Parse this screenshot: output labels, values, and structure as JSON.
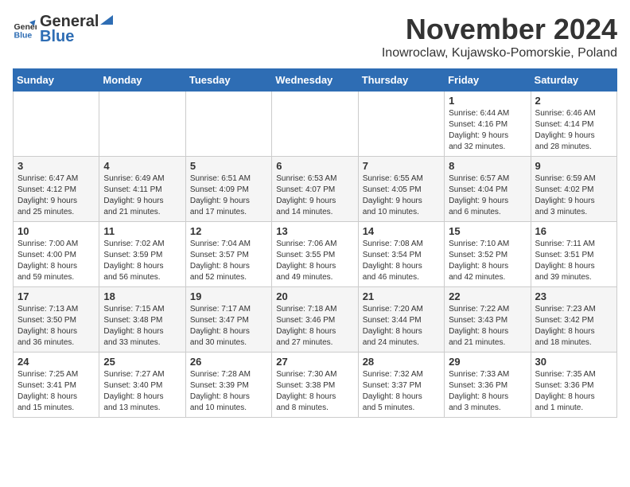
{
  "logo": {
    "general": "General",
    "blue": "Blue"
  },
  "title": "November 2024",
  "location": "Inowroclaw, Kujawsko-Pomorskie, Poland",
  "weekdays": [
    "Sunday",
    "Monday",
    "Tuesday",
    "Wednesday",
    "Thursday",
    "Friday",
    "Saturday"
  ],
  "weeks": [
    [
      {
        "day": "",
        "info": ""
      },
      {
        "day": "",
        "info": ""
      },
      {
        "day": "",
        "info": ""
      },
      {
        "day": "",
        "info": ""
      },
      {
        "day": "",
        "info": ""
      },
      {
        "day": "1",
        "info": "Sunrise: 6:44 AM\nSunset: 4:16 PM\nDaylight: 9 hours\nand 32 minutes."
      },
      {
        "day": "2",
        "info": "Sunrise: 6:46 AM\nSunset: 4:14 PM\nDaylight: 9 hours\nand 28 minutes."
      }
    ],
    [
      {
        "day": "3",
        "info": "Sunrise: 6:47 AM\nSunset: 4:12 PM\nDaylight: 9 hours\nand 25 minutes."
      },
      {
        "day": "4",
        "info": "Sunrise: 6:49 AM\nSunset: 4:11 PM\nDaylight: 9 hours\nand 21 minutes."
      },
      {
        "day": "5",
        "info": "Sunrise: 6:51 AM\nSunset: 4:09 PM\nDaylight: 9 hours\nand 17 minutes."
      },
      {
        "day": "6",
        "info": "Sunrise: 6:53 AM\nSunset: 4:07 PM\nDaylight: 9 hours\nand 14 minutes."
      },
      {
        "day": "7",
        "info": "Sunrise: 6:55 AM\nSunset: 4:05 PM\nDaylight: 9 hours\nand 10 minutes."
      },
      {
        "day": "8",
        "info": "Sunrise: 6:57 AM\nSunset: 4:04 PM\nDaylight: 9 hours\nand 6 minutes."
      },
      {
        "day": "9",
        "info": "Sunrise: 6:59 AM\nSunset: 4:02 PM\nDaylight: 9 hours\nand 3 minutes."
      }
    ],
    [
      {
        "day": "10",
        "info": "Sunrise: 7:00 AM\nSunset: 4:00 PM\nDaylight: 8 hours\nand 59 minutes."
      },
      {
        "day": "11",
        "info": "Sunrise: 7:02 AM\nSunset: 3:59 PM\nDaylight: 8 hours\nand 56 minutes."
      },
      {
        "day": "12",
        "info": "Sunrise: 7:04 AM\nSunset: 3:57 PM\nDaylight: 8 hours\nand 52 minutes."
      },
      {
        "day": "13",
        "info": "Sunrise: 7:06 AM\nSunset: 3:55 PM\nDaylight: 8 hours\nand 49 minutes."
      },
      {
        "day": "14",
        "info": "Sunrise: 7:08 AM\nSunset: 3:54 PM\nDaylight: 8 hours\nand 46 minutes."
      },
      {
        "day": "15",
        "info": "Sunrise: 7:10 AM\nSunset: 3:52 PM\nDaylight: 8 hours\nand 42 minutes."
      },
      {
        "day": "16",
        "info": "Sunrise: 7:11 AM\nSunset: 3:51 PM\nDaylight: 8 hours\nand 39 minutes."
      }
    ],
    [
      {
        "day": "17",
        "info": "Sunrise: 7:13 AM\nSunset: 3:50 PM\nDaylight: 8 hours\nand 36 minutes."
      },
      {
        "day": "18",
        "info": "Sunrise: 7:15 AM\nSunset: 3:48 PM\nDaylight: 8 hours\nand 33 minutes."
      },
      {
        "day": "19",
        "info": "Sunrise: 7:17 AM\nSunset: 3:47 PM\nDaylight: 8 hours\nand 30 minutes."
      },
      {
        "day": "20",
        "info": "Sunrise: 7:18 AM\nSunset: 3:46 PM\nDaylight: 8 hours\nand 27 minutes."
      },
      {
        "day": "21",
        "info": "Sunrise: 7:20 AM\nSunset: 3:44 PM\nDaylight: 8 hours\nand 24 minutes."
      },
      {
        "day": "22",
        "info": "Sunrise: 7:22 AM\nSunset: 3:43 PM\nDaylight: 8 hours\nand 21 minutes."
      },
      {
        "day": "23",
        "info": "Sunrise: 7:23 AM\nSunset: 3:42 PM\nDaylight: 8 hours\nand 18 minutes."
      }
    ],
    [
      {
        "day": "24",
        "info": "Sunrise: 7:25 AM\nSunset: 3:41 PM\nDaylight: 8 hours\nand 15 minutes."
      },
      {
        "day": "25",
        "info": "Sunrise: 7:27 AM\nSunset: 3:40 PM\nDaylight: 8 hours\nand 13 minutes."
      },
      {
        "day": "26",
        "info": "Sunrise: 7:28 AM\nSunset: 3:39 PM\nDaylight: 8 hours\nand 10 minutes."
      },
      {
        "day": "27",
        "info": "Sunrise: 7:30 AM\nSunset: 3:38 PM\nDaylight: 8 hours\nand 8 minutes."
      },
      {
        "day": "28",
        "info": "Sunrise: 7:32 AM\nSunset: 3:37 PM\nDaylight: 8 hours\nand 5 minutes."
      },
      {
        "day": "29",
        "info": "Sunrise: 7:33 AM\nSunset: 3:36 PM\nDaylight: 8 hours\nand 3 minutes."
      },
      {
        "day": "30",
        "info": "Sunrise: 7:35 AM\nSunset: 3:36 PM\nDaylight: 8 hours\nand 1 minute."
      }
    ]
  ]
}
